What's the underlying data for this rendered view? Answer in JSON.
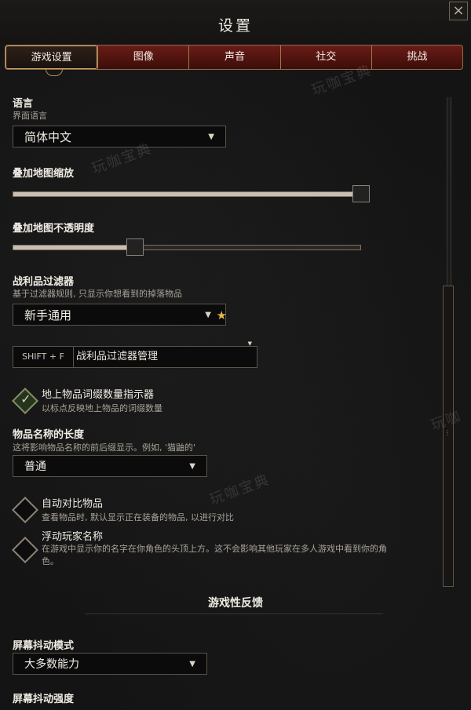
{
  "window": {
    "title": "设置",
    "close_glyph": "×"
  },
  "tabs": [
    {
      "label": "游戏设置",
      "active": true
    },
    {
      "label": "图像",
      "active": false
    },
    {
      "label": "声音",
      "active": false
    },
    {
      "label": "社交",
      "active": false
    },
    {
      "label": "挑战",
      "active": false
    }
  ],
  "settings": {
    "language": {
      "label": "语言",
      "sublabel": "界面语言",
      "value": "简体中文"
    },
    "overlay_zoom": {
      "label": "叠加地图缩放",
      "value_fraction": 1.0
    },
    "overlay_opacity": {
      "label": "叠加地图不透明度",
      "value_fraction": 0.35
    },
    "loot_filter": {
      "label": "战利品过滤器",
      "sublabel": "基于过滤器规则, 只显示你想看到的掉落物品",
      "value": "新手通用",
      "star_glyph": "★"
    },
    "hotkey": {
      "key": "SHIFT + F",
      "label": "战利品过滤器管理"
    },
    "affix_indicator": {
      "label": "地上物品词缀数量指示器",
      "sublabel": "以标点反映地上物品的词缀数量",
      "checked": true
    },
    "item_name_length": {
      "label": "物品名称的长度",
      "sublabel": "这将影响物品名称的前后缀显示。例如, '猫鼬的'",
      "value": "普通"
    },
    "auto_compare": {
      "label": "自动对比物品",
      "sublabel": "查看物品时, 默认显示正在装备的物品, 以进行对比",
      "checked": false
    },
    "floating_names": {
      "label": "浮动玩家名称",
      "sublabel_line1": "在游戏中显示你的名字在你角色的头顶上方。这不会影响其他玩家在多人游戏中看到你的角",
      "sublabel_line2": "色。",
      "checked": false
    },
    "feedback_section": {
      "title": "游戏性反馈"
    },
    "screen_shake_mode": {
      "label": "屏幕抖动模式",
      "value": "大多数能力"
    },
    "screen_shake_strength": {
      "label": "屏幕抖动强度"
    }
  },
  "icons": {
    "caret": "▼",
    "check": "✓",
    "grip": "⋮"
  },
  "watermarks": {
    "text": "玩咖宝典",
    "partial": "玩咖"
  },
  "colors": {
    "tab_red": "#6a1c16",
    "gold_border": "#d2aa66",
    "background": "#141414"
  }
}
